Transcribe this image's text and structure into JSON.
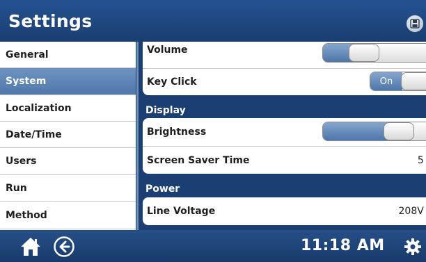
{
  "header": {
    "title": "Settings",
    "save_icon": "save-disk-icon"
  },
  "sidebar": {
    "items": [
      {
        "label": "General",
        "selected": false
      },
      {
        "label": "System",
        "selected": true
      },
      {
        "label": "Localization",
        "selected": false
      },
      {
        "label": "Date/Time",
        "selected": false
      },
      {
        "label": "Users",
        "selected": false
      },
      {
        "label": "Run",
        "selected": false
      },
      {
        "label": "Method",
        "selected": false
      }
    ]
  },
  "main": {
    "volume": {
      "label": "Volume",
      "level": 0.3
    },
    "key_click": {
      "label": "Key Click",
      "state_label": "On"
    },
    "display_section": "Display",
    "brightness": {
      "label": "Brightness",
      "level": 0.7
    },
    "screen_saver": {
      "label": "Screen Saver Time",
      "value": "5 >"
    },
    "power_section": "Power",
    "line_voltage": {
      "label": "Line Voltage",
      "value": "208V >"
    }
  },
  "footer": {
    "home_icon": "home-icon",
    "back_icon": "back-arrow-icon",
    "time": "11:18 AM",
    "settings_icon": "gear-icon"
  },
  "colors": {
    "header_blue": "#1f4a85",
    "selection_blue": "#5b82b4",
    "accent_blue": "#4d76aa"
  }
}
